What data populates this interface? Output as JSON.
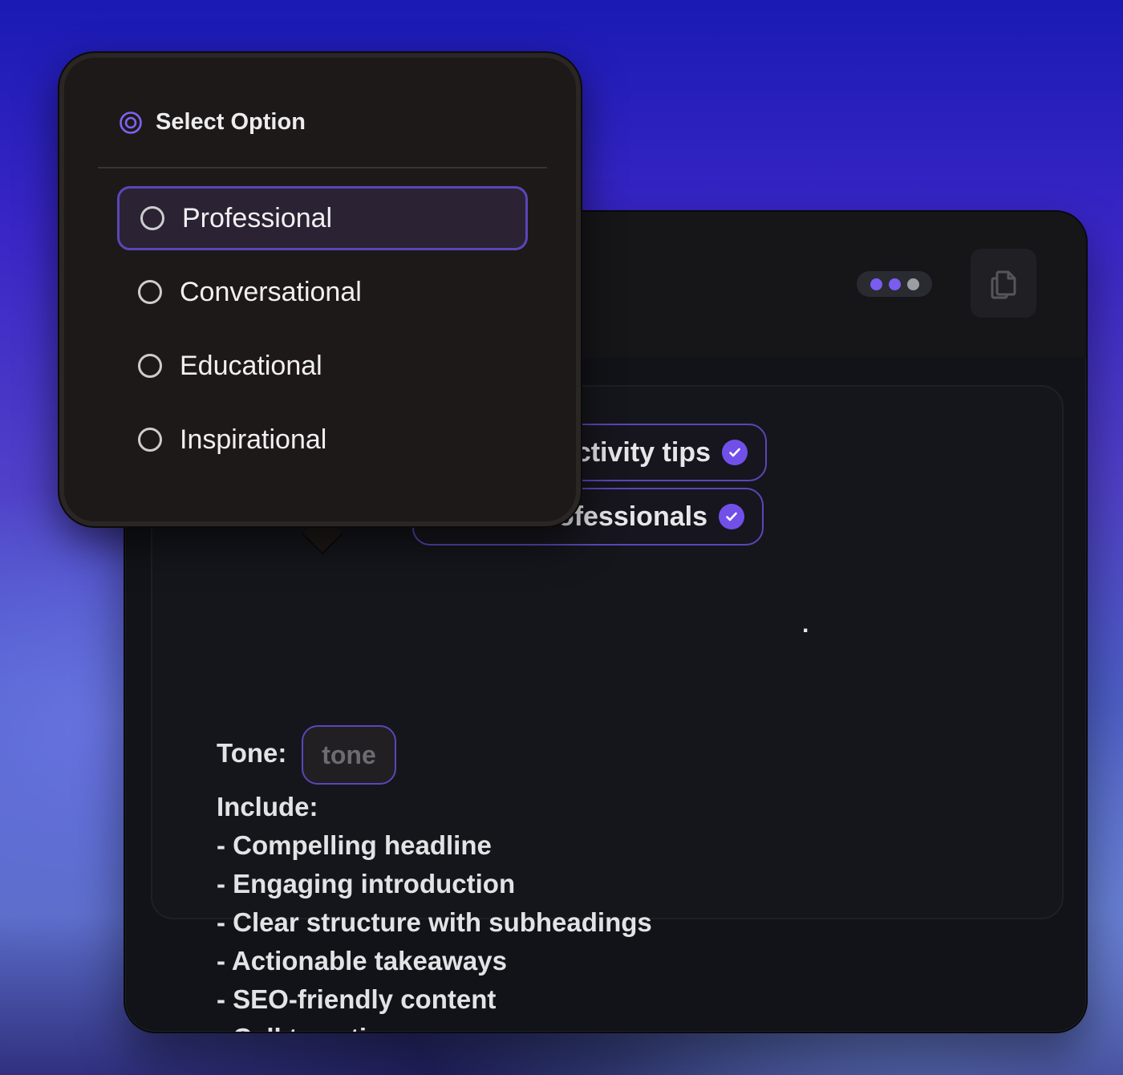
{
  "window": {
    "copy_icon": "copy-icon",
    "dots_icon": "dots-menu-icon"
  },
  "content": {
    "chip1_text": "ctivity tips",
    "chip2_text": "ofessionals",
    "period": ".",
    "tone_label": "Tone:",
    "tone_placeholder": "tone",
    "include_lines": [
      "Include:",
      "- Compelling headline",
      "- Engaging introduction",
      "- Clear structure with subheadings",
      "- Actionable takeaways",
      "- SEO-friendly content",
      "- Call to action"
    ]
  },
  "popover": {
    "title": "Select Option",
    "title_icon": "target-radio-icon",
    "options": [
      {
        "label": "Professional",
        "highlighted": true
      },
      {
        "label": "Conversational",
        "highlighted": false
      },
      {
        "label": "Educational",
        "highlighted": false
      },
      {
        "label": "Inspirational",
        "highlighted": false
      }
    ]
  },
  "colors": {
    "accent": "#7150ea",
    "chip_border": "#5b46b8",
    "popover_bg": "#1d1918",
    "window_bg": "#121318"
  }
}
